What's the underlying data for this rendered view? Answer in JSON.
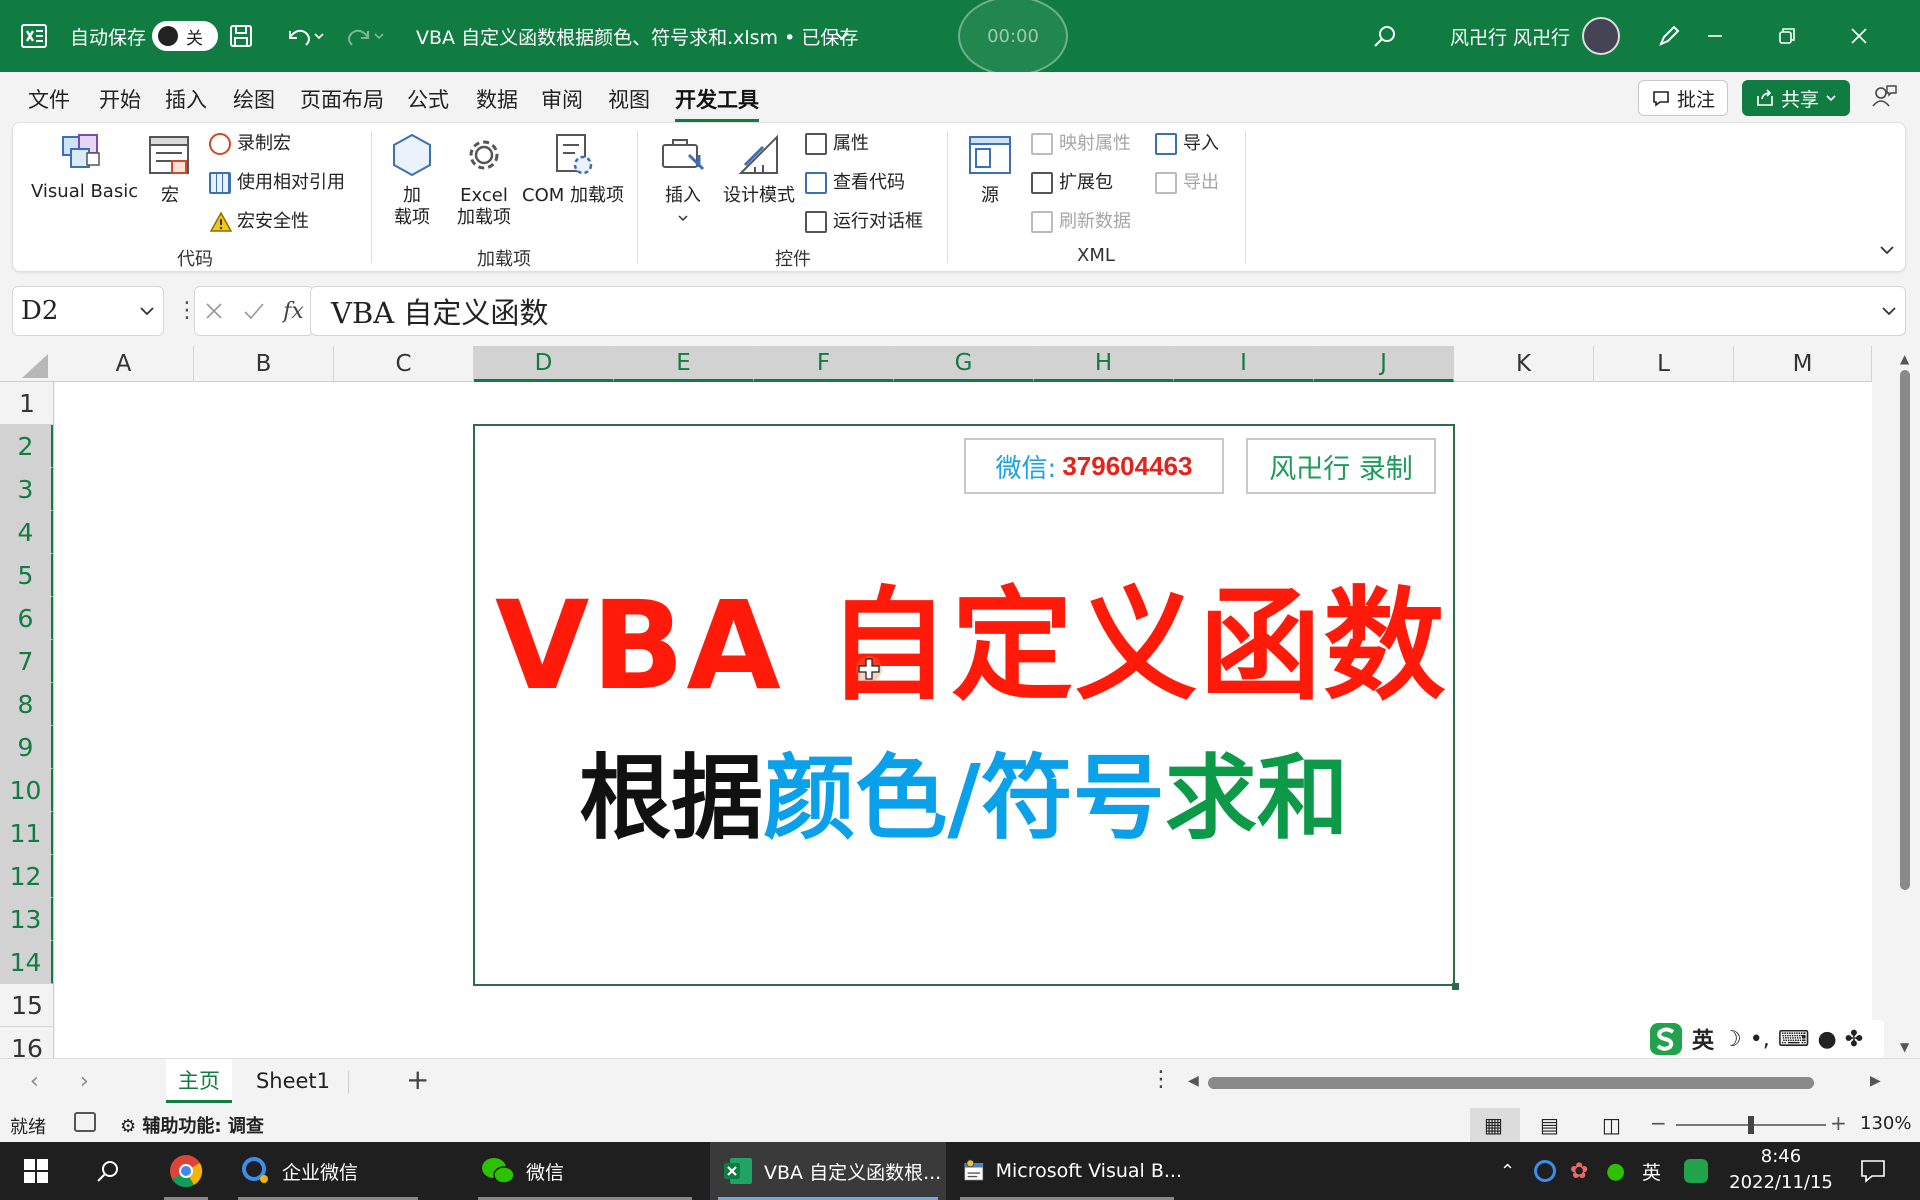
{
  "titlebar": {
    "autosave_label": "自动保存",
    "autosave_state": "关",
    "timer": "00:00",
    "doc_title": "VBA 自定义函数根据颜色、符号求和.xlsm • 已保存",
    "user_name": "风卍行 风卍行"
  },
  "menu_tabs": [
    "文件",
    "开始",
    "插入",
    "绘图",
    "页面布局",
    "公式",
    "数据",
    "审阅",
    "视图",
    "开发工具"
  ],
  "active_tab": "开发工具",
  "actions": {
    "comment": "批注",
    "share": "共享"
  },
  "ribbon": {
    "code": {
      "label": "代码",
      "visual_basic": "Visual Basic",
      "macro": "宏",
      "record_macro": "录制宏",
      "relative_ref": "使用相对引用",
      "macro_security": "宏安全性"
    },
    "addins": {
      "label": "加载项",
      "add_1": "加",
      "add_2": "载项",
      "excel_1": "Excel",
      "excel_2": "加载项",
      "com": "COM 加载项"
    },
    "controls": {
      "label": "控件",
      "insert": "插入",
      "design_mode": "设计模式",
      "properties": "属性",
      "view_code": "查看代码",
      "run_dialog": "运行对话框"
    },
    "xml": {
      "label": "XML",
      "source": "源",
      "map_props": "映射属性",
      "expansion": "扩展包",
      "refresh": "刷新数据",
      "import": "导入",
      "export": "导出"
    }
  },
  "formula_bar": {
    "name_box": "D2",
    "fx": "fx",
    "content": "VBA 自定义函数"
  },
  "columns": [
    "A",
    "B",
    "C",
    "D",
    "E",
    "F",
    "G",
    "H",
    "I",
    "J",
    "K",
    "L",
    "M"
  ],
  "selected_columns": [
    "D",
    "E",
    "F",
    "G",
    "H",
    "I",
    "J"
  ],
  "rows": [
    "1",
    "2",
    "3",
    "4",
    "5",
    "6",
    "7",
    "8",
    "9",
    "10",
    "11",
    "12",
    "13",
    "14",
    "15",
    "16"
  ],
  "card": {
    "wechat_label": "微信:",
    "wechat_id": "379604463",
    "recorder": "风卍行 录制",
    "title": "VBA 自定义函数",
    "subtitle_black": "根据",
    "subtitle_blue": "颜色/符号",
    "subtitle_green": "求和"
  },
  "colors": {
    "excel_green": "#107c41",
    "title_red": "#ff1a0a",
    "wechat_blue": "#1aa1e6",
    "wechat_red": "#e8221a",
    "sub_blue": "#0aa0ea",
    "sub_green": "#0c9a48"
  },
  "sheets": [
    "主页",
    "Sheet1"
  ],
  "active_sheet": "主页",
  "ime": {
    "lang": "英"
  },
  "status": {
    "ready": "就绪",
    "accessibility": "辅助功能: 调查",
    "zoom": "130%"
  },
  "taskbar": {
    "wecom": "企业微信",
    "wechat": "微信",
    "excel": "VBA 自定义函数根...",
    "vba": "Microsoft Visual B...",
    "tray_lang": "英",
    "time": "8:46",
    "date": "2022/11/15"
  },
  "icons": [
    "excel-logo-icon",
    "save-icon",
    "undo-icon",
    "redo-icon",
    "search-icon",
    "pen-icon",
    "minimize-icon",
    "restore-icon",
    "close-icon",
    "comment-icon",
    "share-icon",
    "windows-icon",
    "chrome-icon"
  ]
}
